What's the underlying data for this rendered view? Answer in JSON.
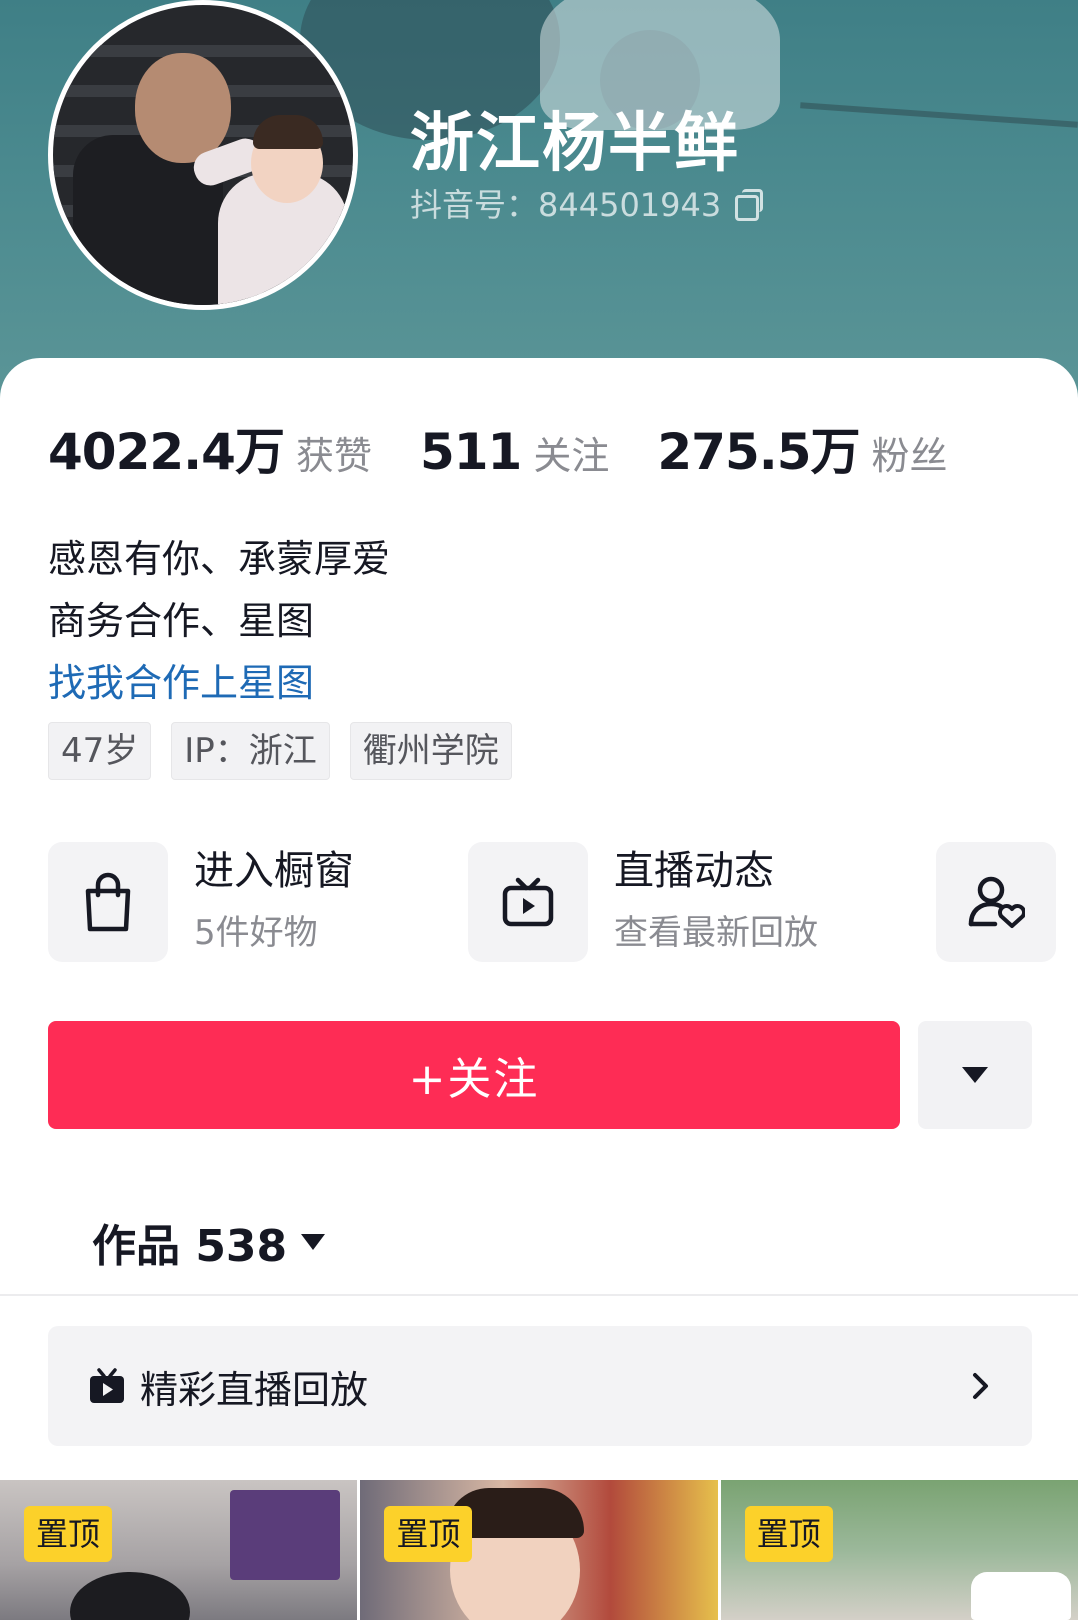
{
  "profile": {
    "nickname": "浙江杨半鲜",
    "douyin_id": "抖音号：844501943"
  },
  "stats": [
    {
      "value": "4022.4万",
      "label": "获赞"
    },
    {
      "value": "511",
      "label": "关注"
    },
    {
      "value": "275.5万",
      "label": "粉丝"
    }
  ],
  "bio": {
    "line1": "感恩有你、承蒙厚爱",
    "line2": "商务合作、星图",
    "link": "找我合作上星图"
  },
  "tags": [
    "47岁",
    "IP：浙江",
    "衢州学院"
  ],
  "features": {
    "shop": {
      "title": "进入橱窗",
      "subtitle": "5件好物",
      "icon": "shopping-bag-icon"
    },
    "live": {
      "title": "直播动态",
      "subtitle": "查看最新回放",
      "icon": "tv-play-icon"
    },
    "friend_icon": "user-heart-icon"
  },
  "actions": {
    "follow_label": "+关注",
    "more_icon": "triangle-down-icon"
  },
  "works": {
    "tab_label": "作品 538"
  },
  "live_replay": {
    "label": "精彩直播回放"
  },
  "videos": [
    {
      "badge": "置顶"
    },
    {
      "badge": "置顶"
    },
    {
      "badge": "置顶"
    }
  ],
  "colors": {
    "accent": "#fe2c55",
    "link": "#1e6ab5",
    "badge": "#fcd12a"
  }
}
